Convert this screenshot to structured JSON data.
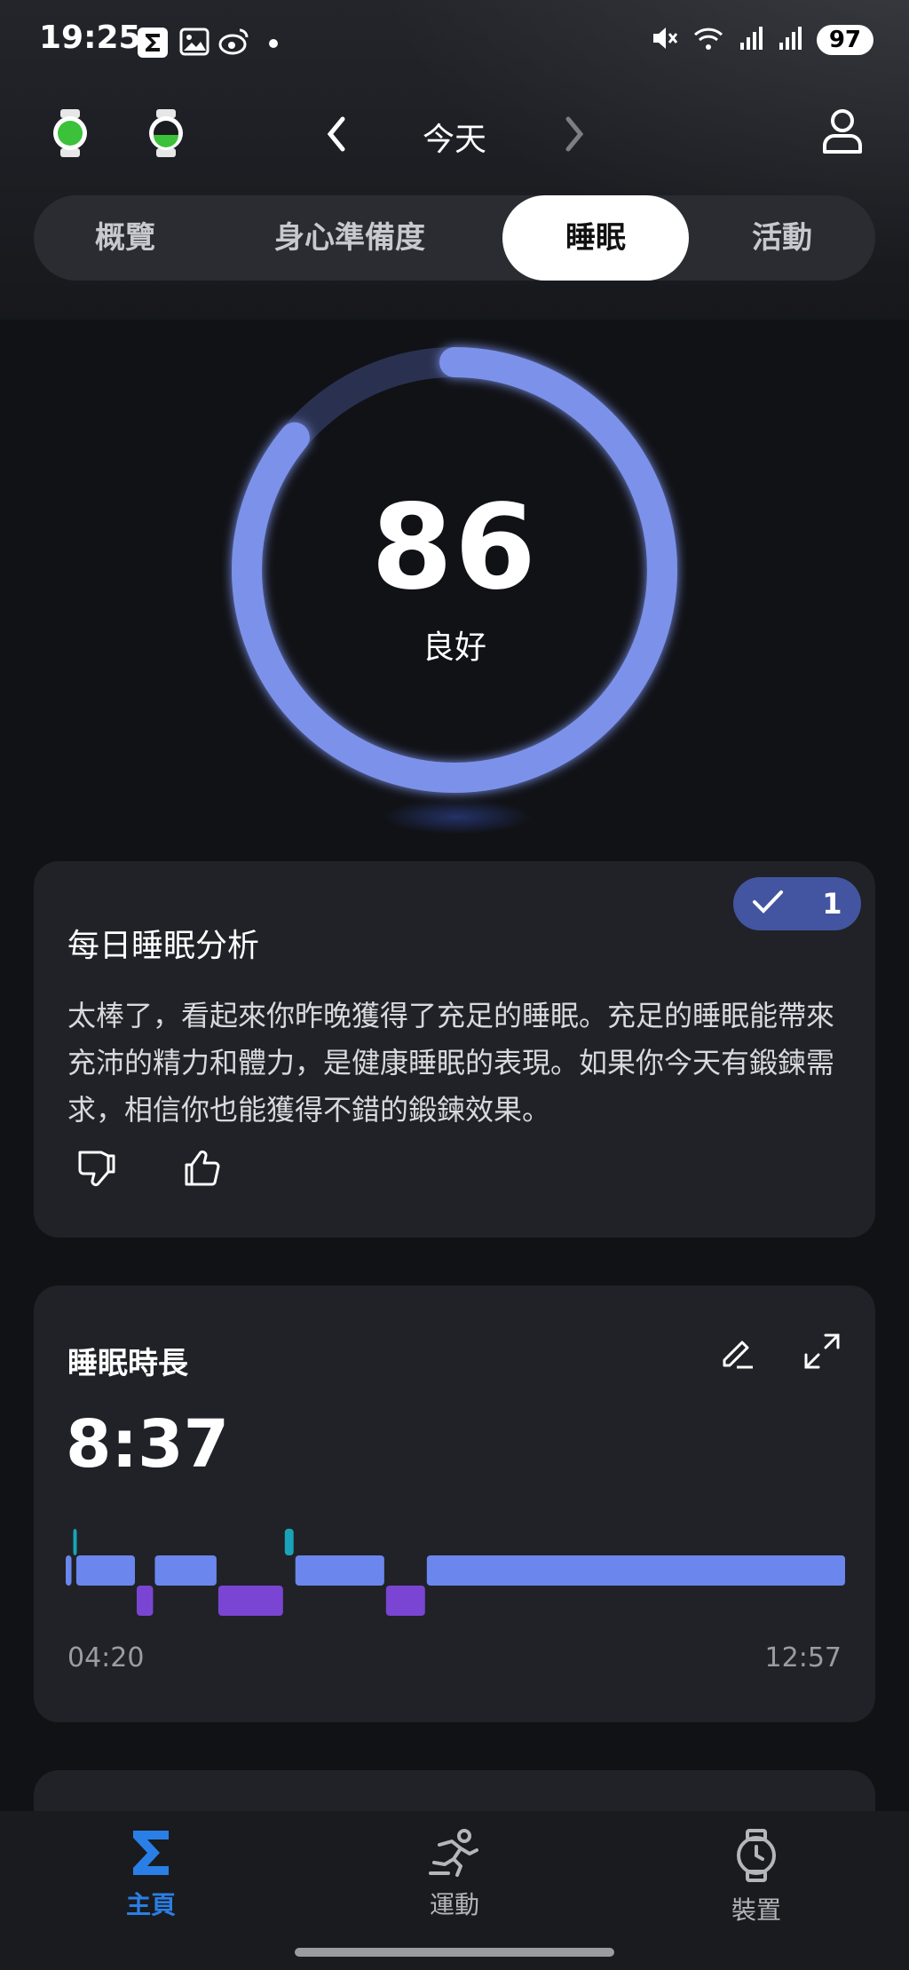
{
  "status_bar": {
    "time": "19:25",
    "battery": "97"
  },
  "header": {
    "title": "今天"
  },
  "tabs": [
    {
      "label": "概覽",
      "active": false
    },
    {
      "label": "身心準備度",
      "active": false
    },
    {
      "label": "睡眠",
      "active": true
    },
    {
      "label": "活動",
      "active": false
    }
  ],
  "score": {
    "value": "86",
    "label": "良好",
    "ring_fill_fraction": 0.86,
    "ring_color": "#7b92ea"
  },
  "analysis": {
    "title": "每日睡眠分析",
    "badge_count": "1",
    "badge_color": "#4355a0",
    "text": "太棒了，看起來你昨晚獲得了充足的睡眠。充足的睡眠能帶來充沛的精力和體力，是健康睡眠的表現。如果你今天有鍛鍊需求，相信你也能獲得不錯的鍛鍊效果。"
  },
  "duration": {
    "title": "睡眠時長",
    "value": "8:37",
    "start_time": "04:20",
    "end_time": "12:57",
    "colors": {
      "light": "#6b86ec",
      "deep": "#7a45d2",
      "awake": "#1aa3b8"
    },
    "segments": [
      {
        "stage": "light",
        "start": "04:20",
        "end": "04:25"
      },
      {
        "stage": "awake",
        "start": "04:25",
        "end": "04:27"
      },
      {
        "stage": "light",
        "start": "04:27",
        "end": "05:07"
      },
      {
        "stage": "deep",
        "start": "05:07",
        "end": "05:19"
      },
      {
        "stage": "light",
        "start": "05:19",
        "end": "06:01"
      },
      {
        "stage": "deep",
        "start": "06:01",
        "end": "06:45"
      },
      {
        "stage": "awake",
        "start": "06:45",
        "end": "06:52"
      },
      {
        "stage": "light",
        "start": "06:52",
        "end": "07:52"
      },
      {
        "stage": "deep",
        "start": "07:52",
        "end": "08:19"
      },
      {
        "stage": "light",
        "start": "08:19",
        "end": "12:57"
      }
    ]
  },
  "bottom_nav": [
    {
      "label": "主頁",
      "icon": "sigma-icon",
      "active": true
    },
    {
      "label": "運動",
      "icon": "running-icon",
      "active": false
    },
    {
      "label": "裝置",
      "icon": "watch-icon",
      "active": false
    }
  ],
  "accent": "#2a7fe6"
}
